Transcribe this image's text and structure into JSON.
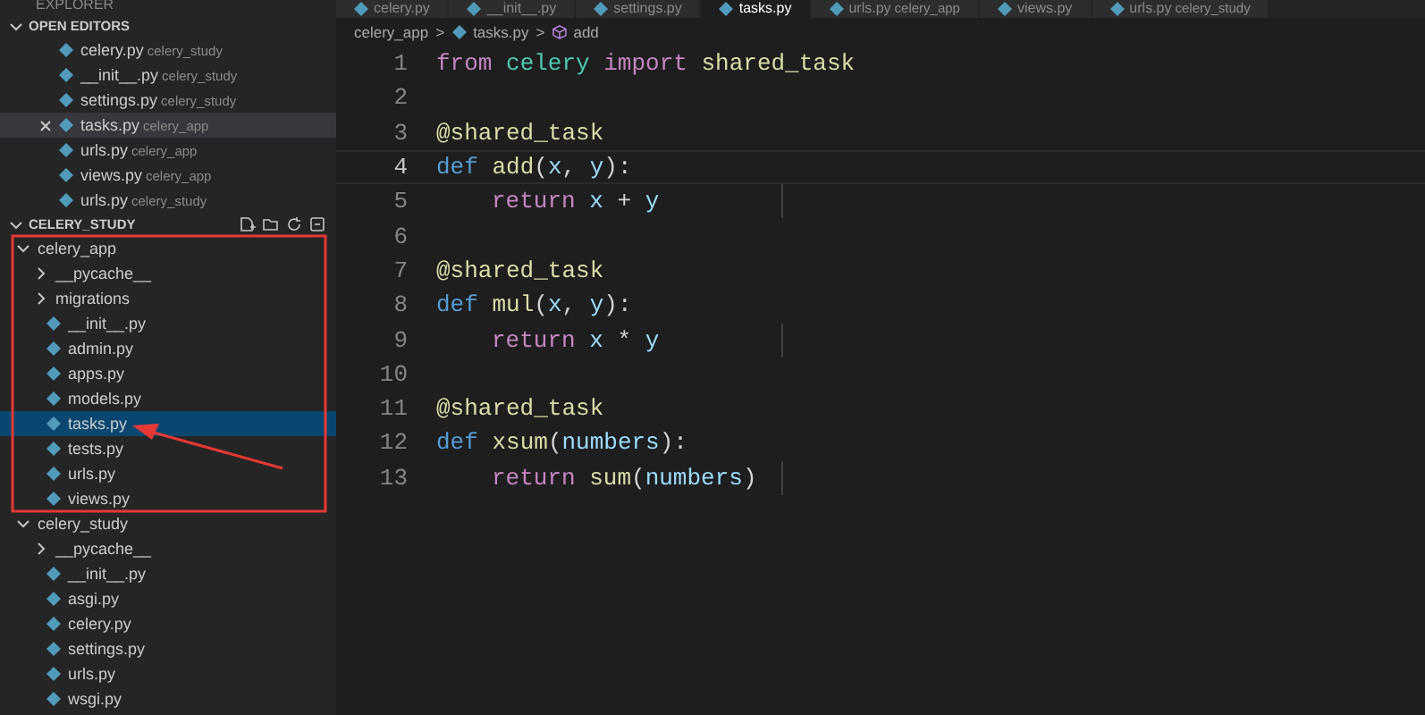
{
  "sidebar": {
    "title": "EXPLORER",
    "open_editors": {
      "title": "OPEN EDITORS",
      "expanded": true,
      "items": [
        {
          "name": "celery.py",
          "folder": "celery_study",
          "selected": false
        },
        {
          "name": "__init__.py",
          "folder": "celery_study",
          "selected": false
        },
        {
          "name": "settings.py",
          "folder": "celery_study",
          "selected": false
        },
        {
          "name": "tasks.py",
          "folder": "celery_app",
          "selected": true
        },
        {
          "name": "urls.py",
          "folder": "celery_app",
          "selected": false
        },
        {
          "name": "views.py",
          "folder": "celery_app",
          "selected": false
        },
        {
          "name": "urls.py",
          "folder": "celery_study",
          "selected": false
        }
      ]
    },
    "project": {
      "title": "CELERY_STUDY",
      "expanded": true,
      "tree": [
        {
          "kind": "folder",
          "name": "celery_app",
          "expanded": true,
          "selected": false,
          "children": [
            {
              "kind": "folder",
              "name": "__pycache__",
              "expanded": false,
              "selected": false
            },
            {
              "kind": "folder",
              "name": "migrations",
              "expanded": false,
              "selected": false
            },
            {
              "kind": "file",
              "name": "__init__.py",
              "selected": false
            },
            {
              "kind": "file",
              "name": "admin.py",
              "selected": false
            },
            {
              "kind": "file",
              "name": "apps.py",
              "selected": false
            },
            {
              "kind": "file",
              "name": "models.py",
              "selected": false
            },
            {
              "kind": "file",
              "name": "tasks.py",
              "selected": true
            },
            {
              "kind": "file",
              "name": "tests.py",
              "selected": false
            },
            {
              "kind": "file",
              "name": "urls.py",
              "selected": false
            },
            {
              "kind": "file",
              "name": "views.py",
              "selected": false
            }
          ]
        },
        {
          "kind": "folder",
          "name": "celery_study",
          "expanded": true,
          "selected": false,
          "children": [
            {
              "kind": "folder",
              "name": "__pycache__",
              "expanded": false,
              "selected": false
            },
            {
              "kind": "file",
              "name": "__init__.py",
              "selected": false
            },
            {
              "kind": "file",
              "name": "asgi.py",
              "selected": false
            },
            {
              "kind": "file",
              "name": "celery.py",
              "selected": false
            },
            {
              "kind": "file",
              "name": "settings.py",
              "selected": false
            },
            {
              "kind": "file",
              "name": "urls.py",
              "selected": false
            },
            {
              "kind": "file",
              "name": "wsgi.py",
              "selected": false
            }
          ]
        }
      ]
    }
  },
  "tabs": [
    {
      "label": "celery.py",
      "selected": false
    },
    {
      "label": "__init__.py",
      "selected": false
    },
    {
      "label": "settings.py",
      "selected": false
    },
    {
      "label": "tasks.py",
      "selected": true
    },
    {
      "label": "urls.py",
      "folder": "celery_app",
      "selected": false
    },
    {
      "label": "views.py",
      "selected": false
    },
    {
      "label": "urls.py",
      "folder": "celery_study",
      "selected": false
    }
  ],
  "breadcrumb": {
    "folder": "celery_app",
    "separator_1": ">",
    "file": "tasks.py",
    "separator_2": ">",
    "symbol": "add"
  },
  "code": [
    {
      "number": "1",
      "current": false,
      "indented": false,
      "tokens": [
        {
          "text": "from ",
          "kind": "keyword"
        },
        {
          "text": "celery ",
          "kind": "module"
        },
        {
          "text": "import ",
          "kind": "keyword"
        },
        {
          "text": "shared_task",
          "kind": "func"
        }
      ]
    },
    {
      "number": "2",
      "current": false,
      "indented": false
    },
    {
      "number": "3",
      "current": false,
      "indented": false,
      "tokens": [
        {
          "text": "@shared_task",
          "kind": "func"
        }
      ]
    },
    {
      "number": "4",
      "current": true,
      "indented": false,
      "tokens": [
        {
          "text": "def ",
          "kind": "storage"
        },
        {
          "text": "add",
          "kind": "func"
        },
        {
          "text": "(",
          "kind": "plain"
        },
        {
          "text": "x",
          "kind": "var"
        },
        {
          "text": ", ",
          "kind": "plain"
        },
        {
          "text": "y",
          "kind": "var"
        },
        {
          "text": "):",
          "kind": "plain"
        }
      ]
    },
    {
      "number": "5",
      "current": false,
      "indented": true,
      "tokens": [
        {
          "text": "return ",
          "kind": "keyword"
        },
        {
          "text": "x",
          "kind": "var"
        },
        {
          "text": " + ",
          "kind": "plain"
        },
        {
          "text": "y",
          "kind": "var"
        }
      ]
    },
    {
      "number": "6",
      "current": false,
      "indented": false
    },
    {
      "number": "7",
      "current": false,
      "indented": false,
      "tokens": [
        {
          "text": "@shared_task",
          "kind": "func"
        }
      ]
    },
    {
      "number": "8",
      "current": false,
      "indented": false,
      "tokens": [
        {
          "text": "def ",
          "kind": "storage"
        },
        {
          "text": "mul",
          "kind": "func"
        },
        {
          "text": "(",
          "kind": "plain"
        },
        {
          "text": "x",
          "kind": "var"
        },
        {
          "text": ", ",
          "kind": "plain"
        },
        {
          "text": "y",
          "kind": "var"
        },
        {
          "text": "):",
          "kind": "plain"
        }
      ]
    },
    {
      "number": "9",
      "current": false,
      "indented": true,
      "tokens": [
        {
          "text": "return ",
          "kind": "keyword"
        },
        {
          "text": "x",
          "kind": "var"
        },
        {
          "text": " * ",
          "kind": "plain"
        },
        {
          "text": "y",
          "kind": "var"
        }
      ]
    },
    {
      "number": "10",
      "current": false,
      "indented": false
    },
    {
      "number": "11",
      "current": false,
      "indented": false,
      "tokens": [
        {
          "text": "@shared_task",
          "kind": "func"
        }
      ]
    },
    {
      "number": "12",
      "current": false,
      "indented": false,
      "tokens": [
        {
          "text": "def ",
          "kind": "storage"
        },
        {
          "text": "xsum",
          "kind": "func"
        },
        {
          "text": "(",
          "kind": "plain"
        },
        {
          "text": "numbers",
          "kind": "var"
        },
        {
          "text": "):",
          "kind": "plain"
        }
      ]
    },
    {
      "number": "13",
      "current": false,
      "indented": true,
      "tokens": [
        {
          "text": "return ",
          "kind": "keyword"
        },
        {
          "text": "sum",
          "kind": "func"
        },
        {
          "text": "(",
          "kind": "plain"
        },
        {
          "text": "numbers",
          "kind": "var"
        },
        {
          "text": ")",
          "kind": "plain"
        }
      ]
    }
  ]
}
